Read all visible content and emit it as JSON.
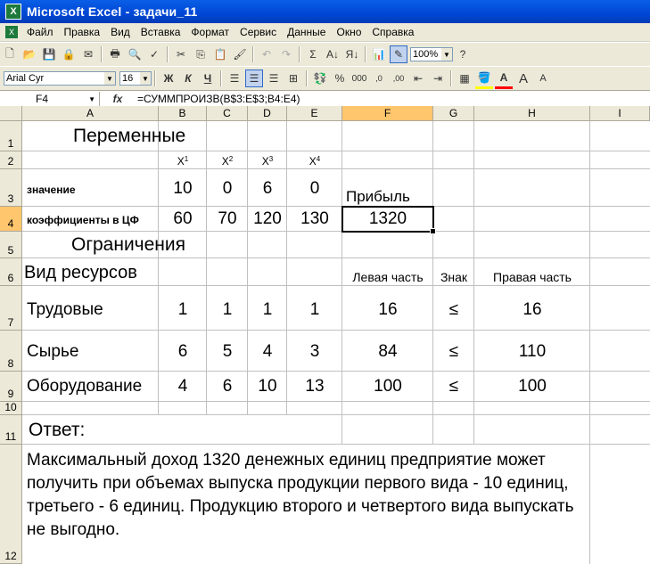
{
  "window": {
    "title": "Microsoft Excel - задачи_11"
  },
  "menu": [
    "Файл",
    "Правка",
    "Вид",
    "Вставка",
    "Формат",
    "Сервис",
    "Данные",
    "Окно",
    "Справка"
  ],
  "toolbar": {
    "zoom": "100%",
    "font": "Arial Cyr",
    "size": "16"
  },
  "formula_bar": {
    "name_box": "F4",
    "fx": "fx",
    "formula": "=СУММПРОИЗВ(B$3:E$3;B4:E4)"
  },
  "columns": [
    "A",
    "B",
    "C",
    "D",
    "E",
    "F",
    "G",
    "H",
    "I"
  ],
  "rows": [
    "1",
    "2",
    "3",
    "4",
    "5",
    "6",
    "7",
    "8",
    "9",
    "10",
    "11",
    "12"
  ],
  "cells": {
    "A1": "Переменные",
    "B2": "X",
    "B2s": "1",
    "C2": "X",
    "C2s": "2",
    "D2": "X",
    "D2s": "3",
    "E2": "X",
    "E2s": "4",
    "A3": "значение",
    "B3": "10",
    "C3": "0",
    "D3": "6",
    "E3": "0",
    "F3": "Прибыль",
    "A4": "коэффициенты в ЦФ",
    "B4": "60",
    "C4": "70",
    "D4": "120",
    "E4": "130",
    "F4": "1320",
    "A5": "Ограничения",
    "A6": "Вид ресурсов",
    "F6": "Левая часть",
    "G6": "Знак",
    "H6": "Правая часть",
    "A7": "Трудовые",
    "B7": "1",
    "C7": "1",
    "D7": "1",
    "E7": "1",
    "F7": "16",
    "G7": "≤",
    "H7": "16",
    "A8": "Сырье",
    "B8": "6",
    "C8": "5",
    "D8": "4",
    "E8": "3",
    "F8": "84",
    "G8": "≤",
    "H8": "110",
    "A9": "Оборудование",
    "B9": "4",
    "C9": "6",
    "D9": "10",
    "E9": "13",
    "F9": "100",
    "G9": "≤",
    "H9": "100",
    "A11": "Ответ:",
    "A12": "Максимальный доход 1320 денежных единиц предприятие может получить при объемах выпуска продукции первого вида - 10 единиц, третьего - 6 единиц. Продукцию второго и четвертого вида выпускать не выгодно."
  }
}
